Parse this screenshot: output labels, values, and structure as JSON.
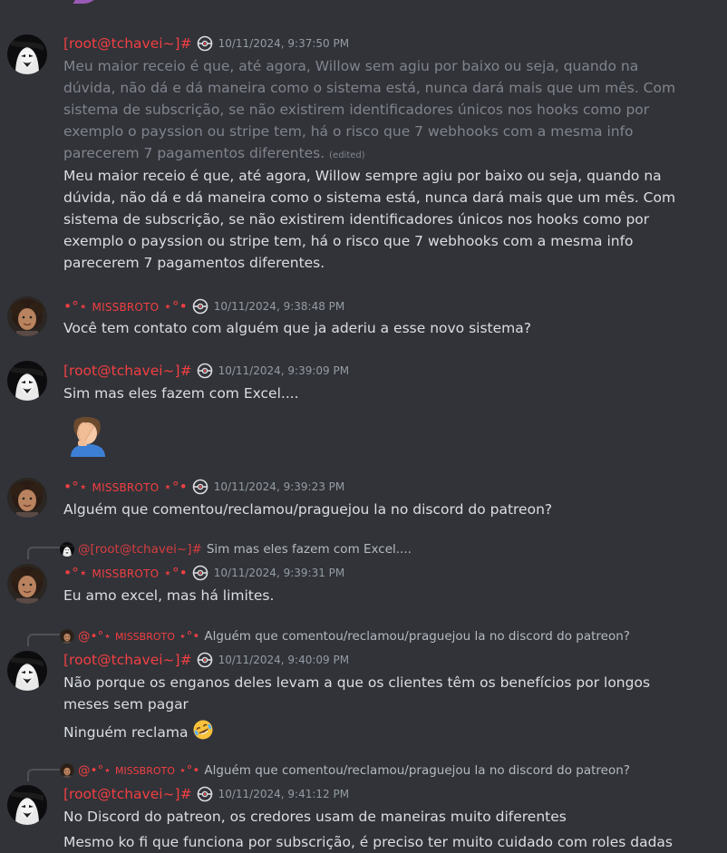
{
  "messages": [
    {
      "author": "[root@tchavei~]#",
      "timestamp": "10/11/2024, 9:37:50 PM",
      "old_text": "Meu maior receio é que, até agora, Willow sem agiu por baixo ou seja, quando na dúvida, não dá e dá maneira como o sistema está, nunca dará mais que um mês. Com sistema de subscrição, se não existirem identificadores únicos nos hooks como por exemplo o payssion ou stripe tem, há o risco que 7 webhooks com a mesma info parecerem 7 pagamentos diferentes.",
      "edited_label": "(edited)",
      "text": "Meu maior receio é que, até agora, Willow sempre agiu por baixo ou seja, quando na dúvida, não dá e dá maneira como o sistema está, nunca dará mais que um mês. Com sistema de subscrição, se não existirem identificadores únicos nos hooks como por exemplo o payssion ou stripe tem, há o risco que 7 webhooks com a mesma info parecerem 7 pagamentos diferentes."
    },
    {
      "author_prefix": "•°⋆ ",
      "author_core": "MissBroto",
      "author_suffix": " ⋆°•",
      "timestamp": "10/11/2024, 9:38:48 PM",
      "text": "Você tem contato com alguém que ja aderiu a esse novo sistema?"
    },
    {
      "author": "[root@tchavei~]#",
      "timestamp": "10/11/2024, 9:39:09 PM",
      "text": "Sim mas eles fazem com Excel....",
      "emoji_icon": "facepalm-emoji"
    },
    {
      "author_prefix": "•°⋆ ",
      "author_core": "MissBroto",
      "author_suffix": " ⋆°•",
      "timestamp": "10/11/2024, 9:39:23 PM",
      "text": "Alguém que comentou/reclamou/praguejou la no discord do patreon?"
    },
    {
      "reply_author": "@[root@tchavei~]#",
      "reply_text": "Sim mas eles fazem com Excel....",
      "author_prefix": "•°⋆ ",
      "author_core": "MissBroto",
      "author_suffix": " ⋆°•",
      "timestamp": "10/11/2024, 9:39:31 PM",
      "text": "Eu amo excel, mas há limites."
    },
    {
      "reply_author_prefix": "@•°⋆ ",
      "reply_author_core": "MissBroto",
      "reply_author_suffix": " ⋆°•",
      "reply_text": "Alguém que comentou/reclamou/praguejou la no discord do patreon?",
      "author": "[root@tchavei~]#",
      "timestamp": "10/11/2024, 9:40:09 PM",
      "text": "Não porque os enganos deles levam a que os clientes têm os benefícios por longos meses sem pagar",
      "text2": "Ninguém reclama",
      "emoji_icon": "rofl-emoji"
    },
    {
      "reply_author_prefix": "@•°⋆ ",
      "reply_author_core": "MissBroto",
      "reply_author_suffix": " ⋆°•",
      "reply_text": "Alguém que comentou/reclamou/praguejou la no discord do patreon?",
      "author": "[root@tchavei~]#",
      "timestamp": "10/11/2024, 9:41:12 PM",
      "text": "No Discord do patreon, os credores usam de maneiras muito diferentes",
      "text2": "Mesmo ko fi que funciona por subscrição, é preciso ter muito cuidado com roles dadas"
    }
  ],
  "colors": {
    "background": "#313338",
    "username": "#f23f43",
    "text": "#dbdee1",
    "muted": "#949ba4"
  }
}
